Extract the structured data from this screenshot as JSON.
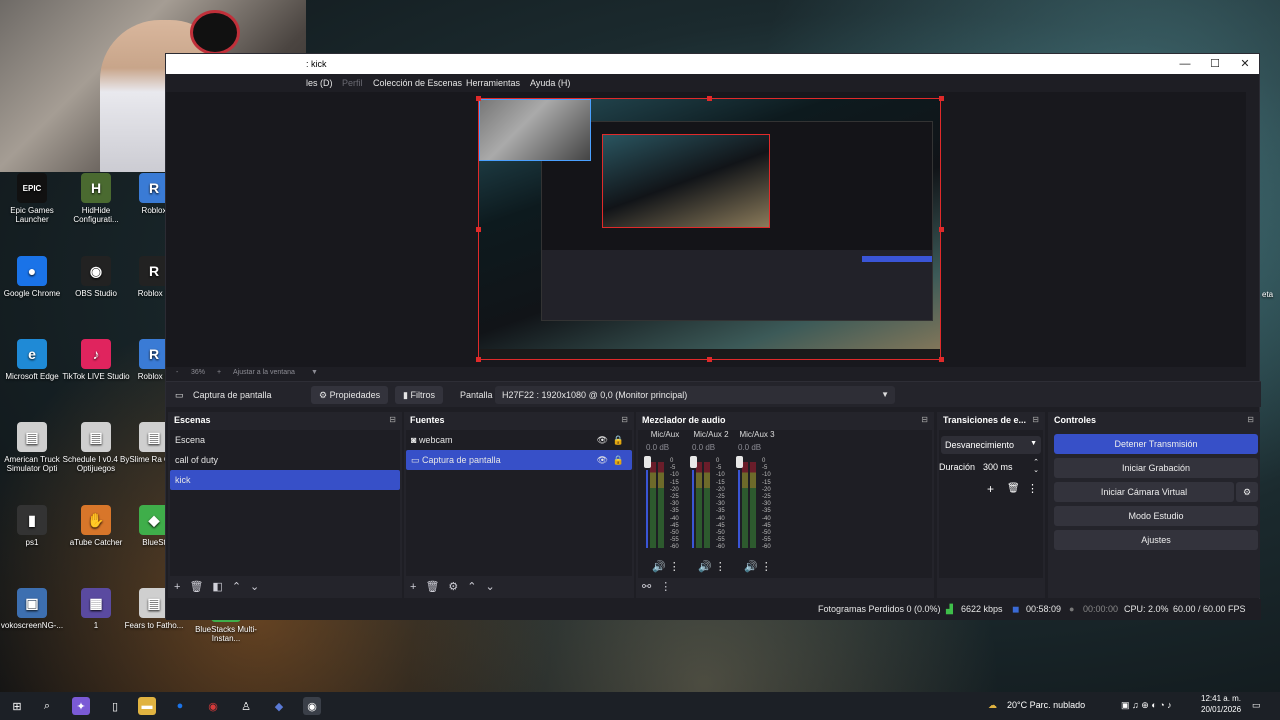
{
  "desktop": {
    "icons": [
      {
        "label": "Epic Games Launcher",
        "glyph": "EPIC",
        "color": "#111111"
      },
      {
        "label": "HidHide Configurati...",
        "glyph": "H",
        "color": "#4a6a30"
      },
      {
        "label": "Roblox",
        "glyph": "R",
        "color": "#3a7bd5"
      },
      {
        "label": "Google Chrome",
        "glyph": "●",
        "color": "#1a73e8"
      },
      {
        "label": "OBS Studio",
        "glyph": "◉",
        "color": "#222222"
      },
      {
        "label": "Roblox S",
        "glyph": "R",
        "color": "#222222"
      },
      {
        "label": "Microsoft Edge",
        "glyph": "e",
        "color": "#1f8ad6"
      },
      {
        "label": "TikTok LIVE Studio",
        "glyph": "♪",
        "color": "#e0245e"
      },
      {
        "label": "Roblox P",
        "glyph": "R",
        "color": "#3a7bd5"
      },
      {
        "label": "American Truck Simulator Opti",
        "glyph": "▤",
        "color": "#cfcfcf"
      },
      {
        "label": "Schedule I v0.4 By Optijuegos",
        "glyph": "▤",
        "color": "#cfcfcf"
      },
      {
        "label": "Slime Ra Opti",
        "glyph": "▤",
        "color": "#cfcfcf"
      },
      {
        "label": "ps1",
        "glyph": "▮",
        "color": "#333333"
      },
      {
        "label": "aTube Catcher",
        "glyph": "✋",
        "color": "#d8762a"
      },
      {
        "label": "BlueSt",
        "glyph": "◆",
        "color": "#3fae4a"
      },
      {
        "label": "vokoscreenNG-...",
        "glyph": "▣",
        "color": "#3d6fb0"
      },
      {
        "label": "1",
        "glyph": "▦",
        "color": "#5a4aa0"
      },
      {
        "label": "Fears to Fatho...",
        "glyph": "▤",
        "color": "#cfcfcf"
      },
      {
        "label": "BlueStacks Multi-Instan...",
        "glyph": "◆",
        "color": "#3fae4a"
      }
    ],
    "right_edge_text": "eta"
  },
  "window": {
    "title": ": kick",
    "menu": [
      "les (D)",
      "Perfil",
      "Colección de Escenas",
      "Herramientas",
      "Ayuda (H)"
    ],
    "controls": {
      "minimize": "—",
      "maximize": "☐",
      "close": "✕"
    }
  },
  "preview": {
    "zoom": "36%",
    "zoom_plus": "+",
    "zoom_minus": "-",
    "fit": "Ajustar a la ventana"
  },
  "context": {
    "source": "Captura de pantalla",
    "properties": "Propiedades",
    "filters": "Filtros",
    "pantalla_label": "Pantalla",
    "pantalla_value": "H27F22    : 1920x1080 @ 0,0 (Monitor principal)"
  },
  "docks": {
    "scenes": {
      "title": "Escenas",
      "items": [
        "Escena",
        "call of duty",
        "kick"
      ],
      "selected": 2
    },
    "sources": {
      "title": "Fuentes",
      "items": [
        "webcam",
        "Captura de pantalla"
      ],
      "selected": 1
    },
    "mixer": {
      "title": "Mezclador de audio",
      "channels": [
        {
          "name": "Mic/Aux",
          "db": "0.0 dB"
        },
        {
          "name": "Mic/Aux 2",
          "db": "0.0 dB"
        },
        {
          "name": "Mic/Aux 3",
          "db": "0.0 dB"
        }
      ],
      "scale": [
        "0",
        "-5",
        "-10",
        "-15",
        "-20",
        "-25",
        "-30",
        "-35",
        "-40",
        "-45",
        "-50",
        "-55",
        "-60"
      ]
    },
    "transitions": {
      "title": "Transiciones de e...",
      "type": "Desvanecimiento",
      "duration_label": "Duración",
      "duration": "300 ms"
    },
    "controls": {
      "title": "Controles",
      "buttons": [
        "Detener Transmisión",
        "Iniciar Grabación",
        "Iniciar Cámara Virtual",
        "Modo Estudio",
        "Ajustes"
      ]
    }
  },
  "status": {
    "dropped": "Fotogramas Perdidos 0 (0.0%)",
    "bitrate": "6622 kbps",
    "stream_time": "00:58:09",
    "rec_time": "00:00:00",
    "cpu": "CPU: 2.0%",
    "fps": "60.00 / 60.00 FPS"
  },
  "taskbar": {
    "weather": "20°C  Parc. nublado",
    "time": "12:41 a. m.",
    "date": "20/01/2026"
  }
}
